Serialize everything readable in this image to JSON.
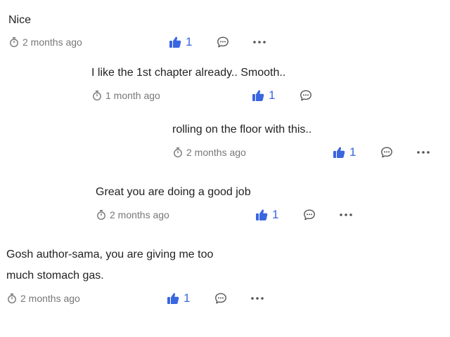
{
  "accent_color": "#3a66e0",
  "comments": [
    {
      "text_lines": [
        "Nice"
      ],
      "time": "2 months ago",
      "likes": "1",
      "has_more": true
    },
    {
      "text_lines": [
        "I like the 1st chapter already.. Smooth.."
      ],
      "time": "1 month ago",
      "likes": "1",
      "has_more": false
    },
    {
      "text_lines": [
        "rolling on the floor with this.."
      ],
      "time": "2 months ago",
      "likes": "1",
      "has_more": true
    },
    {
      "text_lines": [
        "Great you are doing a good job"
      ],
      "time": "2 months ago",
      "likes": "1",
      "has_more": true
    },
    {
      "text_lines": [
        "Gosh author-sama, you are giving me too",
        "much stomach gas."
      ],
      "time": "2 months ago",
      "likes": "1",
      "has_more": true
    }
  ],
  "icons": {
    "time": "stopwatch-icon",
    "like": "thumbs-up-icon",
    "reply": "speech-bubble-icon",
    "more": "more-dots-icon"
  }
}
